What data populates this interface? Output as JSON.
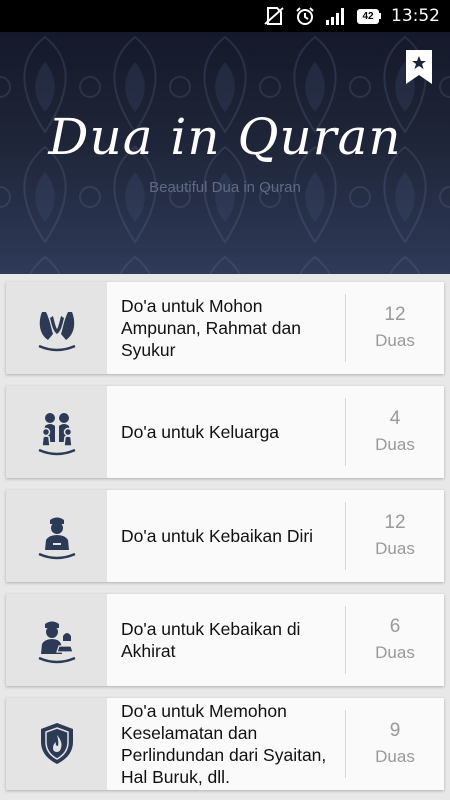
{
  "status_bar": {
    "time": "13:52",
    "battery": "42",
    "icons": [
      "no-sim-icon",
      "alarm-icon",
      "signal-icon",
      "battery-icon"
    ]
  },
  "header": {
    "title": "Dua in Quran",
    "subtitle": "Beautiful Dua in Quran",
    "bookmark_icon": "bookmark-star-icon"
  },
  "colors": {
    "header_dark": "#15192a",
    "header_light": "#2e3a58",
    "icon_navy": "#2d3a55",
    "count_gray": "#9a9a9a"
  },
  "categories": [
    {
      "title": "Do'a untuk Mohon Ampunan, Rahmat dan Syukur",
      "count": "12",
      "unit": "Duas",
      "icon": "praying-hands-icon"
    },
    {
      "title": "Do'a untuk Keluarga",
      "count": "4",
      "unit": "Duas",
      "icon": "family-icon"
    },
    {
      "title": "Do'a untuk Kebaikan Diri",
      "count": "12",
      "unit": "Duas",
      "icon": "person-icon"
    },
    {
      "title": "Do'a untuk Kebaikan di Akhirat",
      "count": "6",
      "unit": "Duas",
      "icon": "person-mosque-icon"
    },
    {
      "title": "Do'a untuk Memohon Keselamatan dan Perlindundan dari Syaitan, Hal Buruk, dll.",
      "count": "9",
      "unit": "Duas",
      "icon": "shield-icon"
    }
  ]
}
